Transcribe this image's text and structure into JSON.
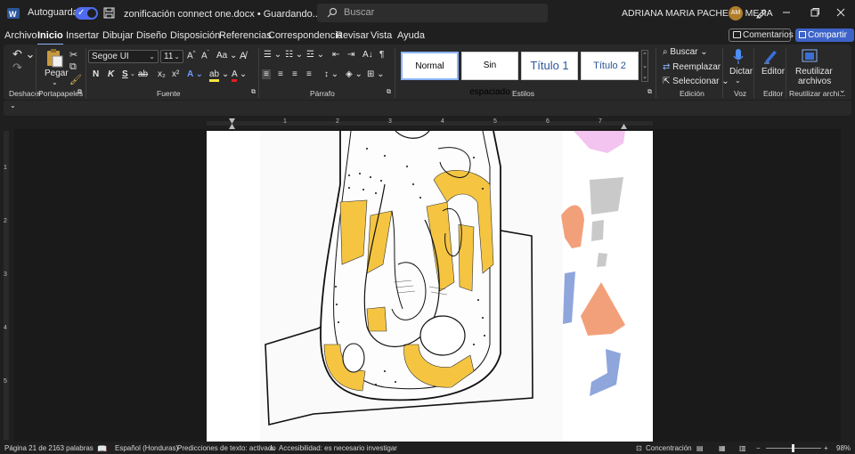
{
  "titlebar": {
    "autosave_label": "Autoguardado",
    "document_title": "zonificación connect one.docx • Guardando... ⌄",
    "search_placeholder": "Buscar",
    "user_name": "ADRIANA MARIA PACHECO MEJIA",
    "user_initials": "AM"
  },
  "tabs": [
    {
      "label": "Archivo"
    },
    {
      "label": "Inicio",
      "active": true
    },
    {
      "label": "Insertar"
    },
    {
      "label": "Dibujar"
    },
    {
      "label": "Diseño"
    },
    {
      "label": "Disposición"
    },
    {
      "label": "Referencias"
    },
    {
      "label": "Correspondencia"
    },
    {
      "label": "Revisar"
    },
    {
      "label": "Vista"
    },
    {
      "label": "Ayuda"
    }
  ],
  "actions": {
    "comments_label": "Comentarios",
    "share_label": "Compartir"
  },
  "ribbon": {
    "groups": {
      "undo": "Deshacer",
      "clipboard": "Portapapeles",
      "font": "Fuente",
      "paragraph": "Párrafo",
      "styles": "Estilos",
      "editing": "Edición",
      "voice": "Voz",
      "editor": "Editor",
      "reuse": "Reutilizar archi..."
    },
    "paste_label": "Pegar",
    "font_name": "Segoe UI",
    "font_size": "11",
    "styles": [
      {
        "label": "Normal"
      },
      {
        "label": "Sin espaciado"
      },
      {
        "label": "Título 1"
      },
      {
        "label": "Título 2"
      }
    ],
    "find_label": "Buscar",
    "replace_label": "Reemplazar",
    "select_label": "Seleccionar",
    "dictate_label": "Dictar",
    "editor_label": "Editor",
    "reuse_label_1": "Reutilizar",
    "reuse_label_2": "archivos",
    "format_buttons": [
      "N",
      "K",
      "S",
      "ab",
      "x₂",
      "x²"
    ]
  },
  "ruler": {
    "numbers": [
      "1",
      "2",
      "3",
      "4",
      "5",
      "6",
      "7"
    ]
  },
  "vruler": {
    "numbers": [
      "1",
      "2",
      "3",
      "4",
      "5"
    ]
  },
  "status": {
    "page": "Página 21 de 21",
    "words": "63 palabras",
    "language": "Español (Honduras)",
    "predictions": "Predicciones de texto: activado",
    "accessibility": "Accesibilidad: es necesario investigar",
    "focus": "Concentración",
    "zoom": "98%"
  },
  "colors": {
    "accent": "#4f6bed",
    "share": "#3d63c8",
    "highlight": "#f5c542",
    "peach": "#f2a07a",
    "blue_shape": "#8fa6dc",
    "gray_shape": "#c9c9c9",
    "pink_shape": "#f2c4ef"
  }
}
